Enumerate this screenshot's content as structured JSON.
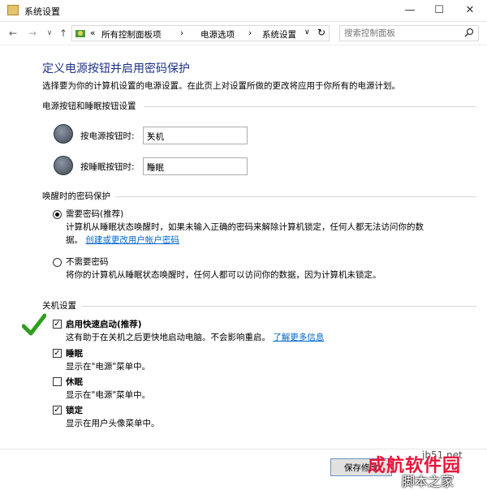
{
  "window": {
    "title": "系统设置",
    "minimize": "—",
    "maximize": "☐",
    "close": "✕"
  },
  "address": {
    "crumbs": [
      "«",
      "所有控制面板项",
      "›",
      "电源选项",
      "›",
      "系统设置"
    ],
    "dropdown": "∨",
    "refresh": "↻",
    "search_placeholder": "搜索控制面板"
  },
  "page": {
    "heading": "定义电源按钮并启用密码保护",
    "description": "选择要为你的计算机设置的电源设置。在此页上对设置所做的更改将应用于你所有的电源计划。"
  },
  "power_group": {
    "title": "电源按钮和睡眠按钮设置",
    "power_label": "按电源按钮时:",
    "power_value": "关机",
    "sleep_label": "按睡眠按钮时:",
    "sleep_value": "睡眠"
  },
  "wake_group": {
    "title": "唤醒时的密码保护",
    "require_title": "需要密码(推荐)",
    "require_desc1": "计算机从睡眠状态唤醒时，如果未输入正确的密码来解除计算机锁定，任何人都无法访问你的数",
    "require_desc2": "据。",
    "require_link": "创建或更改用户帐户密码",
    "norequire_title": "不需要密码",
    "norequire_desc": "将你的计算机从睡眠状态唤醒时，任何人都可以访问你的数据，因为计算机未锁定。"
  },
  "shutdown_group": {
    "title": "关机设置",
    "fast_title": "启用快速启动(推荐)",
    "fast_desc": "这有助于在关机之后更快地启动电脑。不会影响重启。",
    "fast_link": "了解更多信息",
    "sleep_title": "睡眠",
    "sleep_desc": "显示在\"电源\"菜单中。",
    "hibernate_title": "休眠",
    "hibernate_desc": "显示在\"电源\"菜单中。",
    "lock_title": "锁定",
    "lock_desc": "显示在用户头像菜单中。"
  },
  "footer": {
    "save_label": "保存修改"
  },
  "watermark": {
    "line1": "成航软件园",
    "line2": "脚本之家",
    "line3": "jb51.net"
  },
  "checks": {
    "fast": true,
    "sleep": true,
    "hibernate": false,
    "lock": true
  },
  "colors": {
    "heading": "#1e3287",
    "link": "#0066cc",
    "checkmark": "#2e9e1e"
  }
}
